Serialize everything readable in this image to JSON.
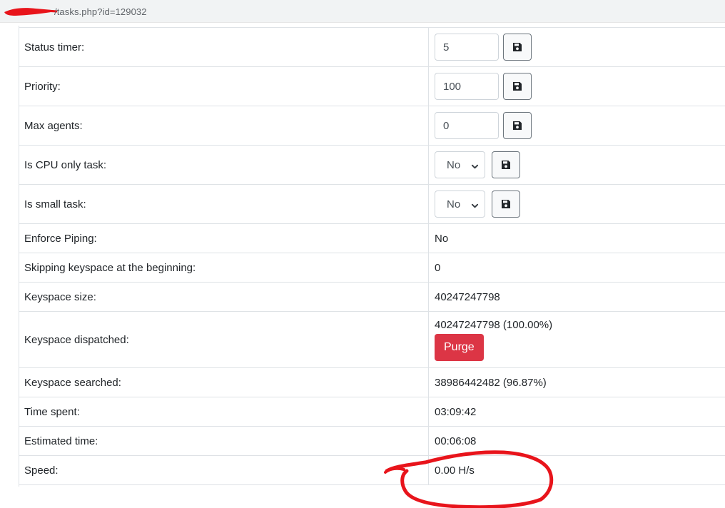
{
  "browser": {
    "url_visible": "/tasks.php?id=129032"
  },
  "rows": [
    {
      "label": "Status timer:",
      "type": "input",
      "value": "5"
    },
    {
      "label": "Priority:",
      "type": "input",
      "value": "100"
    },
    {
      "label": "Max agents:",
      "type": "input",
      "value": "0"
    },
    {
      "label": "Is CPU only task:",
      "type": "select",
      "value": "No"
    },
    {
      "label": "Is small task:",
      "type": "select",
      "value": "No"
    },
    {
      "label": "Enforce Piping:",
      "type": "text",
      "value": "No"
    },
    {
      "label": "Skipping keyspace at the beginning:",
      "type": "text",
      "value": "0"
    },
    {
      "label": "Keyspace size:",
      "type": "text",
      "value": "40247247798"
    },
    {
      "label": "Keyspace dispatched:",
      "type": "text_button",
      "value": "40247247798 (100.00%)",
      "button": "Purge"
    },
    {
      "label": "Keyspace searched:",
      "type": "text",
      "value": "38986442482 (96.87%)"
    },
    {
      "label": "Time spent:",
      "type": "text",
      "value": "03:09:42"
    },
    {
      "label": "Estimated time:",
      "type": "text",
      "value": "00:06:08"
    },
    {
      "label": "Speed:",
      "type": "text",
      "value": "0.00 H/s"
    }
  ],
  "icons": {
    "save": "floppy-disk-icon",
    "dropdown": "chevron-down-icon"
  },
  "colors": {
    "danger": "#dc3545",
    "border": "#dee2e6",
    "annotation": "#e8141b",
    "redaction": "#e8141b"
  }
}
